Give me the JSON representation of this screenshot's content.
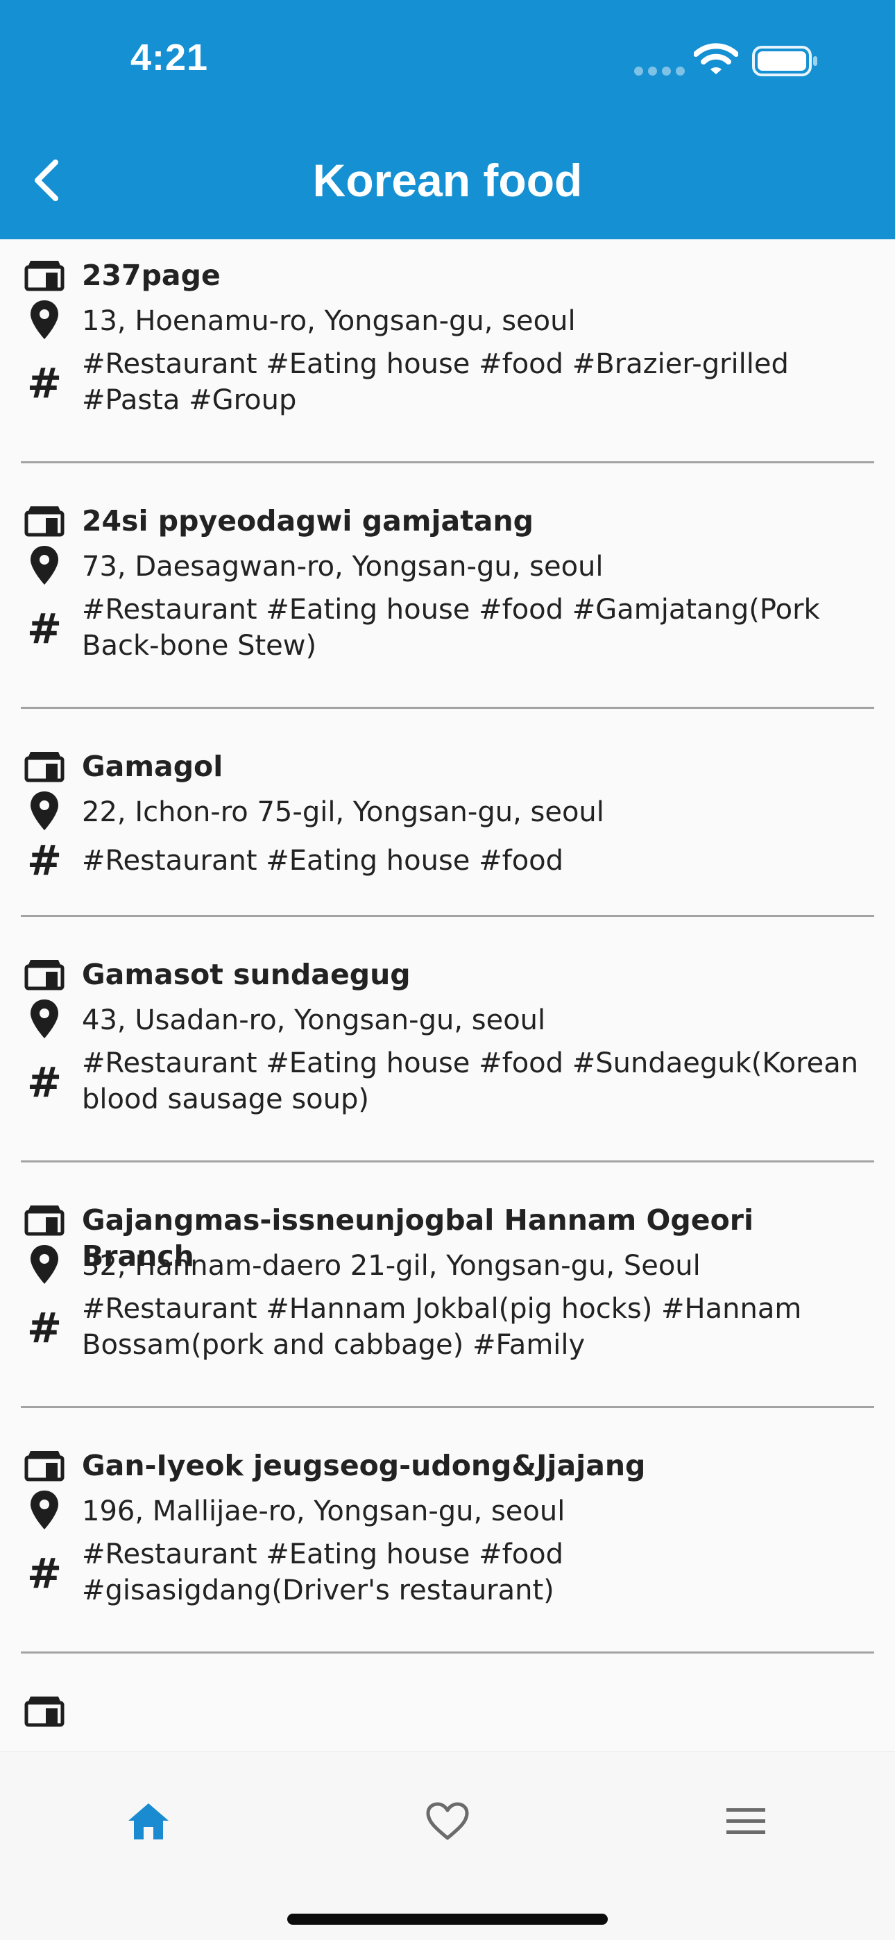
{
  "status_bar": {
    "time": "4:21"
  },
  "app_bar": {
    "title": "Korean food",
    "back_icon": "chevron-left-icon"
  },
  "colors": {
    "app_bar": "#1590d2",
    "active_tab": "#1a8bd0",
    "inactive_tab": "#6b6b6b",
    "divider": "#a3a3a3"
  },
  "restaurants": [
    {
      "name": "237page",
      "address": "13, Hoenamu-ro, Yongsan-gu, seoul",
      "tags": "#Restaurant #Eating house #food #Brazier-grilled #Pasta #Group"
    },
    {
      "name": "24si ppyeodagwi gamjatang",
      "address": "73, Daesagwan-ro, Yongsan-gu, seoul",
      "tags": "#Restaurant #Eating house #food #Gamjatang(Pork Back-bone Stew)"
    },
    {
      "name": "Gamagol",
      "address": "22, Ichon-ro 75-gil, Yongsan-gu, seoul",
      "tags": "#Restaurant #Eating house #food"
    },
    {
      "name": "Gamasot sundaegug",
      "address": "43, Usadan-ro, Yongsan-gu, seoul",
      "tags": "#Restaurant #Eating house #food #Sundaeguk(Korean blood sausage soup)"
    },
    {
      "name": "Gajangmas-issneunjogbal Hannam Ogeori Branch",
      "address": "32, Hannam-daero 21-gil, Yongsan-gu, Seoul",
      "tags": "#Restaurant #Hannam Jokbal(pig hocks) #Hannam Bossam(pork and cabbage) #Family"
    },
    {
      "name": "Gan-Iyeok jeugseog-udong&Jjajang",
      "address": "196, Mallijae-ro, Yongsan-gu, seoul",
      "tags": "#Restaurant #Eating house #food #gisasigdang(Driver's restaurant)"
    }
  ],
  "bottom_nav": [
    {
      "icon": "home-icon",
      "active": true
    },
    {
      "icon": "heart-icon",
      "active": false
    },
    {
      "icon": "menu-icon",
      "active": false
    }
  ]
}
